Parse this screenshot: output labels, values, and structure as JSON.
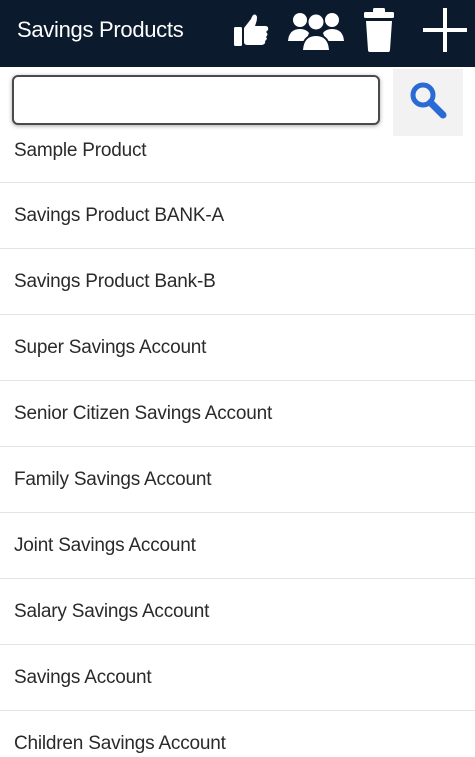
{
  "header": {
    "title": "Savings Products",
    "actions": [
      {
        "icon": "thumbs-up-icon"
      },
      {
        "icon": "group-icon"
      },
      {
        "icon": "trash-icon"
      },
      {
        "icon": "plus-icon"
      }
    ],
    "background": "#0b1a2c"
  },
  "search": {
    "value": "",
    "placeholder": "",
    "button_icon": "search-icon",
    "accent": "#2a6ad4"
  },
  "products": [
    "Sample Product",
    "Savings Product BANK-A",
    "Savings Product Bank-B",
    "Super Savings Account",
    "Senior Citizen Savings Account",
    "Family Savings Account",
    "Joint Savings Account",
    "Salary Savings Account",
    "Savings Account",
    "Children Savings Account"
  ]
}
